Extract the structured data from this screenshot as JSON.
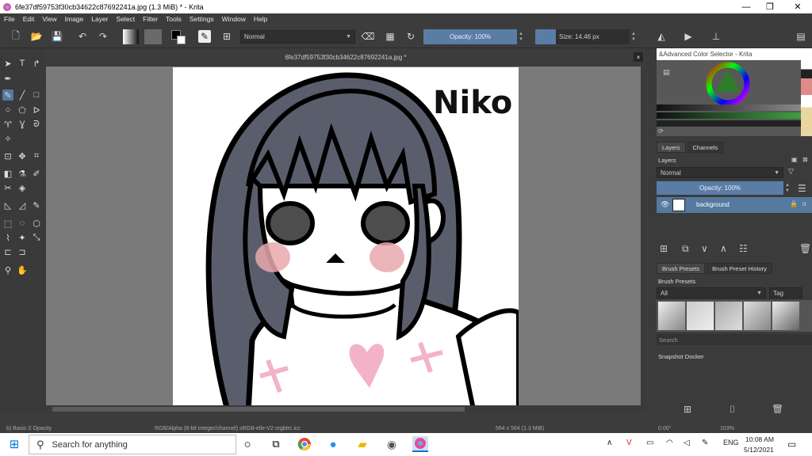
{
  "window": {
    "title": "6fe37df59753f30cb34622c87692241a.jpg (1.3 MiB)  * - Krita",
    "minimize": "—",
    "maximize": "❐",
    "close": "✕"
  },
  "menu": [
    "File",
    "Edit",
    "View",
    "Image",
    "Layer",
    "Select",
    "Filter",
    "Tools",
    "Settings",
    "Window",
    "Help"
  ],
  "toolbar": {
    "blend_mode": "Normal",
    "opacity": "Opacity: 100%",
    "size": "Size: 14.46 px"
  },
  "canvas": {
    "doc_title": "6fe37df59753f30cb34622c87692241a.jpg *",
    "close": "×",
    "artwork_text": "Niko"
  },
  "dockers": {
    "color_selector_title": "&Advanced Color Selector - Krita",
    "tabs_layers": [
      "Layers",
      "Channels"
    ],
    "layers_label": "Layers",
    "blend_mode": "Normal",
    "opacity": "Opacity:  100%",
    "layer_name": "background",
    "tabs_brush": [
      "Brush Presets",
      "Brush Preset History"
    ],
    "brush_presets_label": "Brush Presets",
    "filter_all": "All",
    "tag": "Tag",
    "search_placeholder": "Search",
    "snapshot_label": "Snapshot Docker"
  },
  "statusbar": {
    "brush": "b) Basic-2 Opacity",
    "colorspace": "RGB/Alpha (8-bit integer/channel)  sRGB-elle-V2-srgbtrc.icc",
    "dimensions": "564 x 564 (1.3 MiB)",
    "rotation": "0.00°",
    "zoom": "103%"
  },
  "taskbar": {
    "search_placeholder": "Search for anything",
    "time": "10:08 AM",
    "date": "5/12/2021",
    "lang": "ENG"
  },
  "colors": {
    "accent": "#55799f",
    "hair": "#5a5e6c",
    "blush": "#e8a8ad",
    "heart": "#f2b3c8"
  }
}
